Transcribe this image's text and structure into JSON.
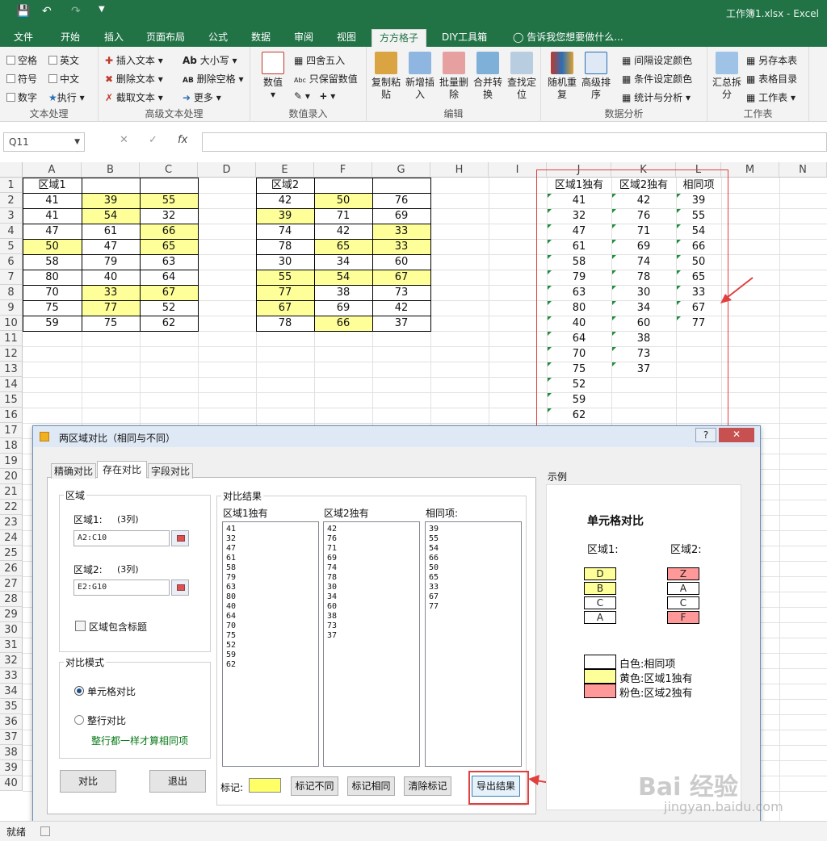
{
  "app": {
    "title": "工作簿1.xlsx - Excel",
    "status": "就绪"
  },
  "colors": {
    "accent": "#217346",
    "highlight_yellow": "#ffff99",
    "highlight_pink": "#ff9999",
    "annotation_red": "#e04040"
  },
  "tabs": [
    "文件",
    "开始",
    "插入",
    "页面布局",
    "公式",
    "数据",
    "审阅",
    "视图",
    "方方格子",
    "DIY工具箱"
  ],
  "tell_me": "告诉我您想要做什么...",
  "ribbon": {
    "text_group": {
      "label": "文本处理",
      "checks": [
        "空格",
        "英文",
        "符号",
        "中文",
        "数字"
      ],
      "exec": "执行"
    },
    "adv_group": {
      "label": "高级文本处理",
      "items": [
        "插入文本",
        "删除文本",
        "截取文本",
        "大小写",
        "删除空格",
        "更多"
      ]
    },
    "num_group": {
      "label": "数值录入",
      "value": "数值",
      "round": "四舍五入",
      "keep": "只保留数值"
    },
    "edit_group": {
      "label": "编辑",
      "buttons": [
        "复制粘贴",
        "新增插入",
        "批量删除",
        "合并转换",
        "查找定位"
      ]
    },
    "analysis_group": {
      "label": "数据分析",
      "buttons": [
        "随机重复",
        "高级排序"
      ],
      "items": [
        "间隔设定颜色",
        "条件设定颜色",
        "统计与分析"
      ]
    },
    "sheet_group": {
      "label": "工作表",
      "button": "汇总拆分",
      "items": [
        "另存本表",
        "表格目录",
        "工作表"
      ]
    }
  },
  "formula": {
    "namebox": "Q11",
    "fx": "fx"
  },
  "columns": [
    "A",
    "B",
    "C",
    "D",
    "E",
    "F",
    "G",
    "H",
    "I",
    "J",
    "K",
    "L",
    "M",
    "N"
  ],
  "rows": [
    "1",
    "2",
    "3",
    "4",
    "5",
    "6",
    "7",
    "8",
    "9",
    "10",
    "11",
    "12",
    "13",
    "14",
    "15",
    "16",
    "17",
    "18",
    "19",
    "20",
    "21",
    "22",
    "23",
    "24",
    "25",
    "26",
    "27",
    "28",
    "29",
    "30",
    "31",
    "32",
    "33",
    "34",
    "35",
    "36",
    "37",
    "38",
    "39",
    "40"
  ],
  "region1": {
    "header": "区域1",
    "values": [
      [
        "41",
        "39",
        "55"
      ],
      [
        "41",
        "54",
        "32"
      ],
      [
        "47",
        "61",
        "66"
      ],
      [
        "50",
        "47",
        "65"
      ],
      [
        "58",
        "79",
        "63"
      ],
      [
        "80",
        "40",
        "64"
      ],
      [
        "70",
        "33",
        "67"
      ],
      [
        "75",
        "77",
        "52"
      ],
      [
        "59",
        "75",
        "62"
      ]
    ],
    "yellow": [
      [
        0,
        1
      ],
      [
        0,
        2
      ],
      [
        1,
        1
      ],
      [
        2,
        2
      ],
      [
        3,
        0
      ],
      [
        3,
        2
      ],
      [
        6,
        1
      ],
      [
        6,
        2
      ],
      [
        7,
        1
      ]
    ]
  },
  "region2": {
    "header": "区域2",
    "values": [
      [
        "42",
        "50",
        "76"
      ],
      [
        "39",
        "71",
        "69"
      ],
      [
        "74",
        "42",
        "33"
      ],
      [
        "78",
        "65",
        "33"
      ],
      [
        "30",
        "34",
        "60"
      ],
      [
        "55",
        "54",
        "67"
      ],
      [
        "77",
        "38",
        "73"
      ],
      [
        "67",
        "69",
        "42"
      ],
      [
        "78",
        "66",
        "37"
      ]
    ],
    "yellow": [
      [
        0,
        1
      ],
      [
        1,
        0
      ],
      [
        2,
        2
      ],
      [
        3,
        1
      ],
      [
        3,
        2
      ],
      [
        5,
        0
      ],
      [
        5,
        1
      ],
      [
        5,
        2
      ],
      [
        6,
        0
      ],
      [
        7,
        0
      ],
      [
        8,
        1
      ]
    ]
  },
  "results": {
    "headers": [
      "区域1独有",
      "区域2独有",
      "相同项"
    ],
    "unique1": [
      "41",
      "32",
      "47",
      "61",
      "58",
      "79",
      "63",
      "80",
      "40",
      "64",
      "70",
      "75",
      "52",
      "59",
      "62"
    ],
    "unique2": [
      "42",
      "76",
      "71",
      "69",
      "74",
      "78",
      "30",
      "34",
      "60",
      "38",
      "73",
      "37"
    ],
    "same": [
      "39",
      "55",
      "54",
      "66",
      "50",
      "65",
      "33",
      "67",
      "77"
    ]
  },
  "dialog": {
    "title": "两区域对比（相同与不同）",
    "help": "?",
    "tabs": [
      "精确对比",
      "存在对比",
      "字段对比"
    ],
    "region_label": "区域",
    "region1_label": "区域1:",
    "region1_cols": "(3列)",
    "region1_value": "A2:C10",
    "region2_label": "区域2:",
    "region2_cols": "(3列)",
    "region2_value": "E2:G10",
    "include_header": "区域包含标题",
    "mode_label": "对比模式",
    "mode_cell": "单元格对比",
    "mode_row": "整行对比",
    "mode_hint": "整行都一样才算相同项",
    "compare": "对比",
    "exit": "退出",
    "result_label": "对比结果",
    "col1": "区域1独有",
    "col2": "区域2独有",
    "col3": "相同项:",
    "mark_label": "标记:",
    "mark_diff": "标记不同",
    "mark_same": "标记相同",
    "clear_mark": "清除标记",
    "export": "导出结果",
    "example_label": "示例",
    "example_title": "单元格对比",
    "ex_r1": "区域1:",
    "ex_r2": "区域2:",
    "ex_col1": [
      "D",
      "B",
      "C",
      "A"
    ],
    "ex_col2": [
      "Z",
      "A",
      "C",
      "F"
    ],
    "legend": [
      "白色:相同项",
      "黄色:区域1独有",
      "粉色:区域2独有"
    ]
  },
  "watermark": {
    "logo": "Bai 经验",
    "url": "jingyan.baidu.com"
  }
}
